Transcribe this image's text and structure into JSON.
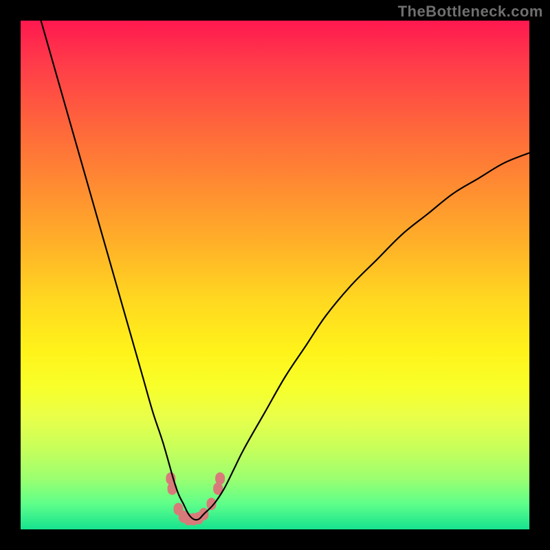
{
  "watermark": "TheBottleneck.com",
  "chart_data": {
    "type": "line",
    "title": "",
    "xlabel": "",
    "ylabel": "",
    "xlim": [
      0,
      100
    ],
    "ylim": [
      0,
      100
    ],
    "grid": false,
    "legend": false,
    "background_gradient": {
      "top": "#ff184f",
      "mid": "#fff31a",
      "bottom": "#16e28e"
    },
    "series": [
      {
        "name": "curve",
        "color": "#000000",
        "x": [
          4,
          6,
          8,
          10,
          12,
          14,
          16,
          18,
          20,
          22,
          24,
          26,
          28,
          30,
          31,
          32,
          33,
          34,
          35,
          36,
          38,
          40,
          42,
          44,
          48,
          52,
          56,
          60,
          65,
          70,
          75,
          80,
          85,
          90,
          95,
          100
        ],
        "y": [
          100,
          93,
          86,
          79,
          72,
          65,
          58,
          51,
          44,
          37,
          30,
          23,
          17,
          10,
          7,
          5,
          3,
          2,
          2,
          3,
          5,
          8,
          12,
          16,
          23,
          30,
          36,
          42,
          48,
          53,
          58,
          62,
          66,
          69,
          72,
          74
        ]
      }
    ],
    "markers": {
      "description": "salmon rounded markers near curve minimum",
      "color": "#d97a7a",
      "points": [
        {
          "x": 29.5,
          "y": 10
        },
        {
          "x": 29.8,
          "y": 8
        },
        {
          "x": 31,
          "y": 4
        },
        {
          "x": 32,
          "y": 2.5
        },
        {
          "x": 33,
          "y": 2
        },
        {
          "x": 34,
          "y": 2
        },
        {
          "x": 35,
          "y": 2.2
        },
        {
          "x": 36,
          "y": 3
        },
        {
          "x": 37.5,
          "y": 5
        },
        {
          "x": 38.8,
          "y": 8
        },
        {
          "x": 39.2,
          "y": 10
        }
      ]
    }
  }
}
